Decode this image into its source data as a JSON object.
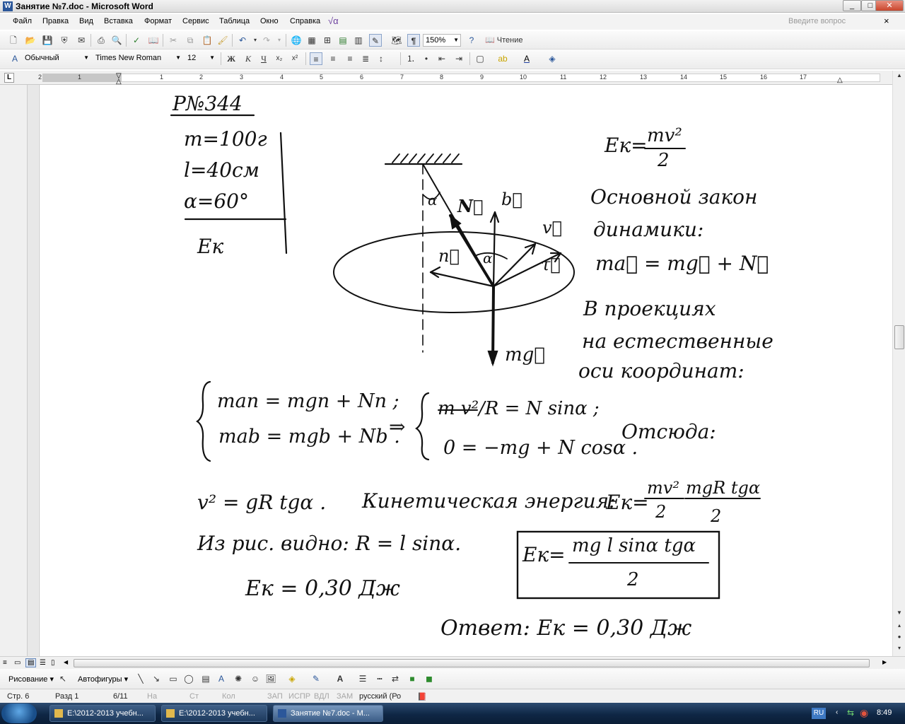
{
  "window": {
    "title": "Занятие №7.doc - Microsoft Word",
    "buttons": {
      "minimize": "_",
      "maximize": "□",
      "close": "✕"
    }
  },
  "menu": {
    "items": [
      "Файл",
      "Правка",
      "Вид",
      "Вставка",
      "Формат",
      "Сервис",
      "Таблица",
      "Окно",
      "Справка"
    ],
    "ask_placeholder": "Введите вопрос",
    "doc_close": "×"
  },
  "standard_toolbar": {
    "zoom": "150%",
    "reading_label": "Чтение"
  },
  "formatting_toolbar": {
    "style": "Обычный",
    "font": "Times New Roman",
    "size": "12",
    "bold": "Ж",
    "italic": "К",
    "underline": "Ч"
  },
  "ruler": {
    "numbers": [
      "2",
      "1",
      "1",
      "2",
      "3",
      "4",
      "5",
      "6",
      "7",
      "8",
      "9",
      "10",
      "11",
      "12",
      "13",
      "14",
      "15",
      "16",
      "17"
    ],
    "tab_selector": "L"
  },
  "document": {
    "problem_number": "Р№344",
    "given": [
      "m=100г",
      "l=40см",
      "α=60°"
    ],
    "find": "Eк",
    "ek_formula": {
      "lhs": "Eк=",
      "num": "mv²",
      "den": "2"
    },
    "law_title": [
      "Основной закон",
      "динамики:"
    ],
    "law_eq": "ma⃗ = mg⃗ + N⃗",
    "projection_text": [
      "В проекциях",
      "на естественные",
      "оси координат:"
    ],
    "diagram_labels": {
      "alpha_top": "α",
      "N": "N⃗",
      "b": "b⃗",
      "v": "v⃗",
      "tau": "τ⃗",
      "n": "n⃗",
      "alpha_mid": "α",
      "mg": "mg⃗"
    },
    "system1": [
      "man = mgn + Nn ;",
      "mab = mgb + Nb ."
    ],
    "implies": "⇒",
    "system2": [
      "m v²/R = N sinα ;",
      "0 = −mg + N cosα ."
    ],
    "hence": "Отсюда:",
    "line_v2": "v² = gR tgα .",
    "kinetic_label": "Кинетическая энергия:",
    "kinetic_formula": {
      "lhs": "Eк=",
      "num1": "mv²",
      "den1": "2",
      "num2": "mgR tgα",
      "den2": "2"
    },
    "fig_text": "Из рис. видно: R = l sinα.",
    "boxed": {
      "lhs": "Eк=",
      "num": "mg l sinα tgα",
      "den": "2"
    },
    "result": "Eк = 0,30 Дж",
    "answer": "Ответ: Eк = 0,30 Дж"
  },
  "drawing_toolbar": {
    "draw_label": "Рисование",
    "autoshapes_label": "Автофигуры"
  },
  "status": {
    "page": "Стр. 6",
    "section": "Разд 1",
    "pages": "6/11",
    "at": "На",
    "line": "Ст",
    "col": "Кол",
    "rec": "ЗАП",
    "trk": "ИСПР",
    "ext": "ВДЛ",
    "ovr": "ЗАМ",
    "lang": "русский (Ро"
  },
  "taskbar": {
    "tasks": [
      "E:\\2012-2013 учебн...",
      "E:\\2012-2013 учебн...",
      "Занятие №7.doc - M..."
    ],
    "lang": "RU",
    "clock": "8:49"
  },
  "colors": {
    "accent": "#2b579a",
    "taskbar": "#0f2745",
    "ink": "#111111"
  }
}
